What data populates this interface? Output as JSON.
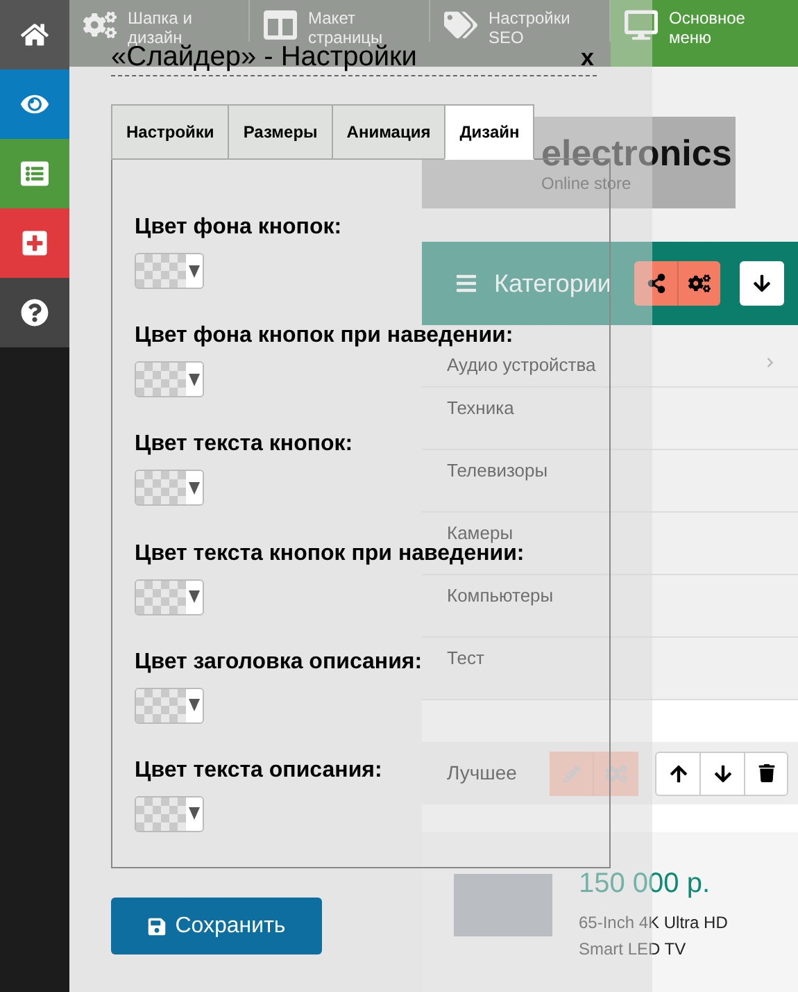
{
  "sidebar": {
    "items": [
      {
        "kind": "home",
        "color": "#555555"
      },
      {
        "kind": "eye",
        "color": "#0b7dbf"
      },
      {
        "kind": "list",
        "color": "#4e9a3c"
      },
      {
        "kind": "plus",
        "color": "#e0393e"
      },
      {
        "kind": "help",
        "color": "#444444"
      }
    ]
  },
  "top_bar": {
    "items": [
      {
        "kind": "gears",
        "label": "Шапка и дизайн",
        "selected": false
      },
      {
        "kind": "layout",
        "label": "Макет страницы",
        "selected": false
      },
      {
        "kind": "tags",
        "label": "Настройки SEO",
        "selected": false
      },
      {
        "kind": "monitor",
        "label": "Основное меню",
        "selected": true
      }
    ]
  },
  "store": {
    "logo": "electronics",
    "logo_subtitle": "Online store",
    "categories": {
      "title": "Категории",
      "items": [
        {
          "label": "Аудио устройства",
          "has_children": true
        },
        {
          "label": "Техника",
          "has_children": false
        },
        {
          "label": "Телевизоры",
          "has_children": false
        },
        {
          "label": "Камеры",
          "has_children": false
        },
        {
          "label": "Компьютеры",
          "has_children": false
        },
        {
          "label": "Тест",
          "has_children": false
        }
      ]
    },
    "best": {
      "title": "Лучшее"
    },
    "product": {
      "price": "150 000 р.",
      "name": "65-Inch 4K Ultra HD Smart LED TV"
    }
  },
  "dialog": {
    "title": "«Слайдер» - Настройки",
    "close": "x",
    "tabs": [
      {
        "label": "Настройки",
        "selected": false
      },
      {
        "label": "Размеры",
        "selected": false
      },
      {
        "label": "Анимация",
        "selected": false
      },
      {
        "label": "Дизайн",
        "selected": true
      }
    ],
    "fields": [
      {
        "label": "Цвет фона кнопок:"
      },
      {
        "label": "Цвет фона кнопок при наведении:"
      },
      {
        "label": "Цвет текста кнопок:"
      },
      {
        "label": "Цвет текста кнопок при наведении:"
      },
      {
        "label": "Цвет заголовка описания:"
      },
      {
        "label": "Цвет текста описания:"
      }
    ],
    "save": "Сохранить"
  }
}
